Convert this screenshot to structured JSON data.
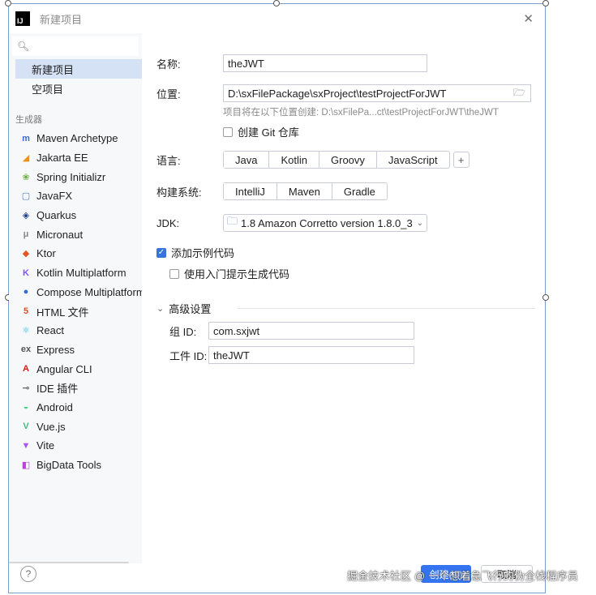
{
  "window": {
    "title": "新建项目",
    "close": "✕"
  },
  "sidebar": {
    "search_placeholder": "",
    "items": [
      "新建项目",
      "空项目"
    ],
    "generators_label": "生成器",
    "generators": [
      {
        "label": "Maven Archetype",
        "icon": "m",
        "color": "#3b6bd6"
      },
      {
        "label": "Jakarta EE",
        "icon": "◢",
        "color": "#f29111"
      },
      {
        "label": "Spring Initializr",
        "icon": "❀",
        "color": "#6db33f"
      },
      {
        "label": "JavaFX",
        "icon": "▢",
        "color": "#4a7bd3"
      },
      {
        "label": "Quarkus",
        "icon": "◈",
        "color": "#1b3d8a"
      },
      {
        "label": "Micronaut",
        "icon": "μ",
        "color": "#888888"
      },
      {
        "label": "Ktor",
        "icon": "◆",
        "color": "#e8541d"
      },
      {
        "label": "Kotlin Multiplatform",
        "icon": "K",
        "color": "#7f52ff"
      },
      {
        "label": "Compose Multiplatform",
        "icon": "●",
        "color": "#2c6ad8"
      },
      {
        "label": "HTML 文件",
        "icon": "5",
        "color": "#e44d26"
      },
      {
        "label": "React",
        "icon": "⚛",
        "color": "#2bb6e3"
      },
      {
        "label": "Express",
        "icon": "ex",
        "color": "#555555"
      },
      {
        "label": "Angular CLI",
        "icon": "A",
        "color": "#dd1b16"
      },
      {
        "label": "IDE 插件",
        "icon": "⊸",
        "color": "#666666"
      },
      {
        "label": "Android",
        "icon": "◒",
        "color": "#3ddc84"
      },
      {
        "label": "Vue.js",
        "icon": "V",
        "color": "#42b883"
      },
      {
        "label": "Vite",
        "icon": "▼",
        "color": "#a855f7"
      },
      {
        "label": "BigData Tools",
        "icon": "◧",
        "color": "#c03fe0"
      }
    ]
  },
  "form": {
    "name_label": "名称:",
    "name_value": "theJWT",
    "location_label": "位置:",
    "location_value": "D:\\sxFilePackage\\sxProject\\testProjectForJWT",
    "location_hint": "项目将在以下位置创建: D:\\sxFilePa...ct\\testProjectForJWT\\theJWT",
    "git_label": "创建 Git 仓库",
    "language_label": "语言:",
    "languages": [
      "Java",
      "Kotlin",
      "Groovy",
      "JavaScript"
    ],
    "build_label": "构建系统:",
    "build_systems": [
      "IntelliJ",
      "Maven",
      "Gradle"
    ],
    "jdk_label": "JDK:",
    "jdk_value": "1.8 Amazon Corretto version 1.8.0_3",
    "sample_label": "添加示例代码",
    "onboarding_label": "使用入门提示生成代码",
    "advanced_label": "高级设置",
    "group_label": "组 ID:",
    "group_value": "com.sxjwt",
    "artifact_label": "工件 ID:",
    "artifact_value": "theJWT"
  },
  "footer": {
    "help": "?",
    "create": "创建(C)",
    "cancel": "取消"
  },
  "watermark": "掘金技术社区 @ 一个想着急飞行的伪全栈程序员"
}
